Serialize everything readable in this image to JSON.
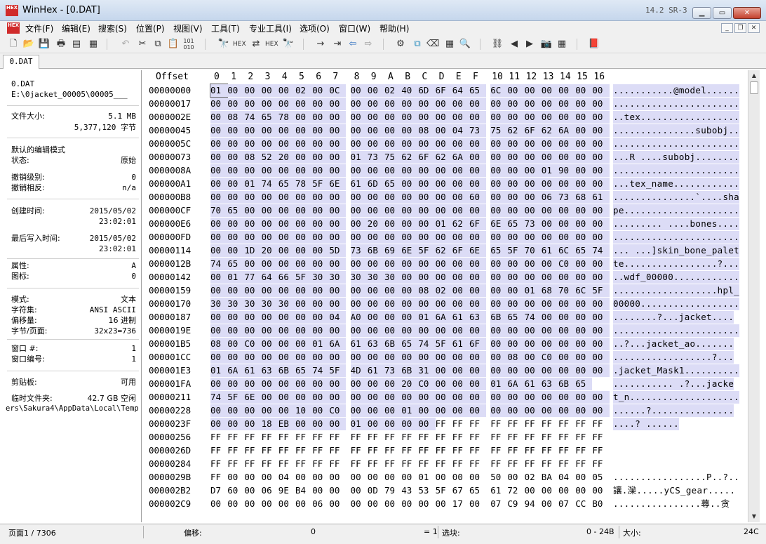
{
  "window": {
    "title": "WinHex - [0.DAT]",
    "version": "14.2 SR-3",
    "app_icon_text": "HEX"
  },
  "menu": [
    "文件(F)",
    "编辑(E)",
    "搜索(S)",
    "位置(P)",
    "视图(V)",
    "工具(T)",
    "专业工具(I)",
    "选项(O)",
    "窗口(W)",
    "帮助(H)"
  ],
  "tab": {
    "label": "0.DAT"
  },
  "info": {
    "file_name": "0.DAT",
    "file_path": "E:\\0jacket_00005\\00005___",
    "file_size_label": "文件大小:",
    "file_size_mb": "5.1 MB",
    "file_size_bytes": "5,377,120 字节",
    "edit_mode_label": "默认的编辑模式",
    "state_label": "状态:",
    "state_value": "原始",
    "undo_level_label": "撤销级别:",
    "undo_level_value": "0",
    "undo_reverse_label": "撤销相反:",
    "undo_reverse_value": "n/a",
    "created_label": "创建时间:",
    "created_date": "2015/05/02",
    "created_time": "23:02:01",
    "written_label": "最后写入时间:",
    "written_date": "2015/05/02",
    "written_time": "23:02:01",
    "attr_label": "属性:",
    "attr_value": "A",
    "icon_label": "图标:",
    "icon_value": "0",
    "mode_label": "模式:",
    "mode_value": "文本",
    "charset_label": "字符集:",
    "charset_value": "ANSI ASCII",
    "offset_label": "偏移量:",
    "offset_value": "16 进制",
    "bpp_label": "字节/页面:",
    "bpp_value": "32x23=736",
    "window_num_label": "窗口 #:",
    "window_num_value": "1",
    "window_id_label": "窗口编号:",
    "window_id_value": "1",
    "clipboard_label": "剪贴板:",
    "clipboard_value": "可用",
    "temp_label": "临时文件夹:",
    "temp_value": "42.7 GB 空闲",
    "temp_path": "ers\\Sakura4\\AppData\\Local\\Temp"
  },
  "hex": {
    "offset_header": "Offset",
    "column_headers": [
      "0",
      "1",
      "2",
      "3",
      "4",
      "5",
      "6",
      "7",
      "8",
      "9",
      "A",
      "B",
      "C",
      "D",
      "E",
      "F",
      "10",
      "11",
      "12",
      "13",
      "14",
      "15",
      "16"
    ],
    "rows": [
      {
        "off": "00000000",
        "bytes": "01 00 00 00 00 02 00 0C 00 00 02 40 6D 6F 64 65 6C 00 00 00 00 00 00",
        "text": "...........@model......"
      },
      {
        "off": "00000017",
        "bytes": "00 00 00 00 00 00 00 00 00 00 00 00 00 00 00 00 00 00 00 00 00 00 00",
        "text": "......................."
      },
      {
        "off": "0000002E",
        "bytes": "00 08 74 65 78 00 00 00 00 00 00 00 00 00 00 00 00 00 00 00 00 00 00",
        "text": "..tex.................."
      },
      {
        "off": "00000045",
        "bytes": "00 00 00 00 00 00 00 00 00 00 00 00 08 00 04 73 75 62 6F 62 6A 00 00",
        "text": "...............subobj.."
      },
      {
        "off": "0000005C",
        "bytes": "00 00 00 00 00 00 00 00 00 00 00 00 00 00 00 00 00 00 00 00 00 00 00",
        "text": "......................."
      },
      {
        "off": "00000073",
        "bytes": "00 00 08 52 20 00 00 00 01 73 75 62 6F 62 6A 00 00 00 00 00 00 00 00",
        "text": "...R ....subobj........"
      },
      {
        "off": "0000008A",
        "bytes": "00 00 00 00 00 00 00 00 00 00 00 00 00 00 00 00 00 00 00 01 90 00 00",
        "text": "......................."
      },
      {
        "off": "000000A1",
        "bytes": "00 00 01 74 65 78 5F 6E 61 6D 65 00 00 00 00 00 00 00 00 00 00 00 00",
        "text": "...tex_name............"
      },
      {
        "off": "000000B8",
        "bytes": "00 00 00 00 00 00 00 00 00 00 00 00 00 00 00 60 00 00 00 06 73 68 61",
        "text": "...............`....sha"
      },
      {
        "off": "000000CF",
        "bytes": "70 65 00 00 00 00 00 00 00 00 00 00 00 00 00 00 00 00 00 00 00 00 00",
        "text": "pe....................."
      },
      {
        "off": "000000E6",
        "bytes": "00 00 00 00 00 00 00 00 00 20 00 00 00 01 62 6F 6E 65 73 00 00 00 00",
        "text": "......... ....bones...."
      },
      {
        "off": "000000FD",
        "bytes": "00 00 00 00 00 00 00 00 00 00 00 00 00 00 00 00 00 00 00 00 00 00 00",
        "text": "......................."
      },
      {
        "off": "00000114",
        "bytes": "00 00 1D 20 00 00 00 5D 73 6B 69 6E 5F 62 6F 6E 65 5F 70 61 6C 65 74",
        "text": "... ...]skin_bone_palet"
      },
      {
        "off": "0000012B",
        "bytes": "74 65 00 00 00 00 00 00 00 00 00 00 00 00 00 00 00 00 00 00 C0 00 00",
        "text": "te.................?..."
      },
      {
        "off": "00000142",
        "bytes": "00 01 77 64 66 5F 30 30 30 30 30 00 00 00 00 00 00 00 00 00 00 00 00",
        "text": "..wdf_00000............"
      },
      {
        "off": "00000159",
        "bytes": "00 00 00 00 00 00 00 00 00 00 00 00 08 02 00 00 00 00 01 68 70 6C 5F",
        "text": "...................hpl_"
      },
      {
        "off": "00000170",
        "bytes": "30 30 30 30 30 00 00 00 00 00 00 00 00 00 00 00 00 00 00 00 00 00 00",
        "text": "00000.................."
      },
      {
        "off": "00000187",
        "bytes": "00 00 00 00 00 00 00 04 A0 00 00 00 01 6A 61 63 6B 65 74 00 00 00 00",
        "text": "........?...jacket...."
      },
      {
        "off": "0000019E",
        "bytes": "00 00 00 00 00 00 00 00 00 00 00 00 00 00 00 00 00 00 00 00 00 00 00",
        "text": "......................."
      },
      {
        "off": "000001B5",
        "bytes": "08 00 C0 00 00 00 01 6A 61 63 6B 65 74 5F 61 6F 00 00 00 00 00 00 00",
        "text": "..?...jacket_ao......."
      },
      {
        "off": "000001CC",
        "bytes": "00 00 00 00 00 00 00 00 00 00 00 00 00 00 00 00 00 08 00 C0 00 00 00",
        "text": "..................?..."
      },
      {
        "off": "000001E3",
        "bytes": "01 6A 61 63 6B 65 74 5F 4D 61 73 6B 31 00 00 00 00 00 00 00 00 00 00",
        "text": ".jacket_Mask1.........."
      },
      {
        "off": "000001FA",
        "bytes": "00 00 00 00 00 00 00 00 00 00 00 20 C0 00 00 00 01 6A 61 63 6B 65",
        "text": "........... .?...jacke"
      },
      {
        "off": "00000211",
        "bytes": "74 5F 6E 00 00 00 00 00 00 00 00 00 00 00 00 00 00 00 00 00 00 00 00",
        "text": "t_n...................."
      },
      {
        "off": "00000228",
        "bytes": "00 00 00 00 00 10 00 C0 00 00 00 01 00 00 00 00 00 00 00 00 00 00 00",
        "text": "......?..............."
      },
      {
        "off": "0000023F",
        "bytes": "00 00 00 18 EB 00 00 00 01 00 00 00 00 FF FF FF FF FF FF FF FF FF FF",
        "text": "....? ......"
      },
      {
        "off": "00000256",
        "bytes": "FF FF FF FF FF FF FF FF FF FF FF FF FF FF FF FF FF FF FF FF FF FF FF",
        "text": ""
      },
      {
        "off": "0000026D",
        "bytes": "FF FF FF FF FF FF FF FF FF FF FF FF FF FF FF FF FF FF FF FF FF FF FF",
        "text": ""
      },
      {
        "off": "00000284",
        "bytes": "FF FF FF FF FF FF FF FF FF FF FF FF FF FF FF FF FF FF FF FF FF FF FF",
        "text": ""
      },
      {
        "off": "0000029B",
        "bytes": "FF 00 00 00 04 00 00 00 00 00 00 00 01 00 00 00 50 00 02 BA 04 00 05",
        "text": ".................P..?.."
      },
      {
        "off": "000002B2",
        "bytes": "D7 60 00 06 9E B4 00 00 00 0D 79 43 53 5F 67 65 61 72 00 00 00 00 00",
        "text": "讓.灤.....yCS_gear....."
      },
      {
        "off": "000002C9",
        "bytes": "00 00 00 00 00 00 06 00 00 00 00 00 00 00 17 00 07 C9 94 00 07 CC B0",
        "text": "................蕁..贪"
      }
    ],
    "highlight_rows": 25
  },
  "status": {
    "page": "页面1 / 7306",
    "offset_label": "偏移:",
    "offset_value": "0",
    "eq": "= 1",
    "block_label": "选块:",
    "block_value": "0 - 24B",
    "size_label": "大小:",
    "size_value": "24C"
  }
}
